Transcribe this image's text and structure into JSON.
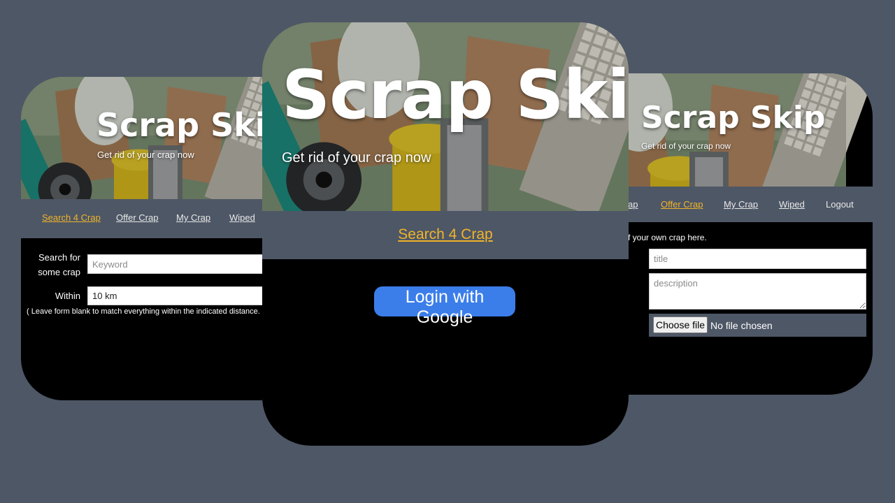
{
  "left": {
    "title": "Scrap Skip",
    "subtitle": "Get rid of your crap now",
    "nav": [
      "Search 4 Crap",
      "Offer Crap",
      "My Crap",
      "Wiped"
    ],
    "search_label": "Search for\nsome crap",
    "search_placeholder": "Keyword",
    "within_label": "Within",
    "within_value": "10 km",
    "note": "( Leave form blank to match everything within the indicated distance. )"
  },
  "center": {
    "title": "Scrap Skip",
    "subtitle": "Get rid of your crap now",
    "nav_link": "Search 4 Crap",
    "login_button": "Login with Google"
  },
  "right": {
    "title": "Scrap Skip",
    "subtitle": "Get rid of your crap now",
    "nav": [
      "ap",
      "Offer Crap",
      "My Crap",
      "Wiped",
      "Logout"
    ],
    "intro": "f your own crap here.",
    "title_placeholder": "title",
    "description_placeholder": "description",
    "file_button": "Choose file",
    "file_status": "No file chosen"
  },
  "colors": {
    "background": "#4e5766",
    "accent": "#f0b429",
    "button": "#3b7eea"
  }
}
